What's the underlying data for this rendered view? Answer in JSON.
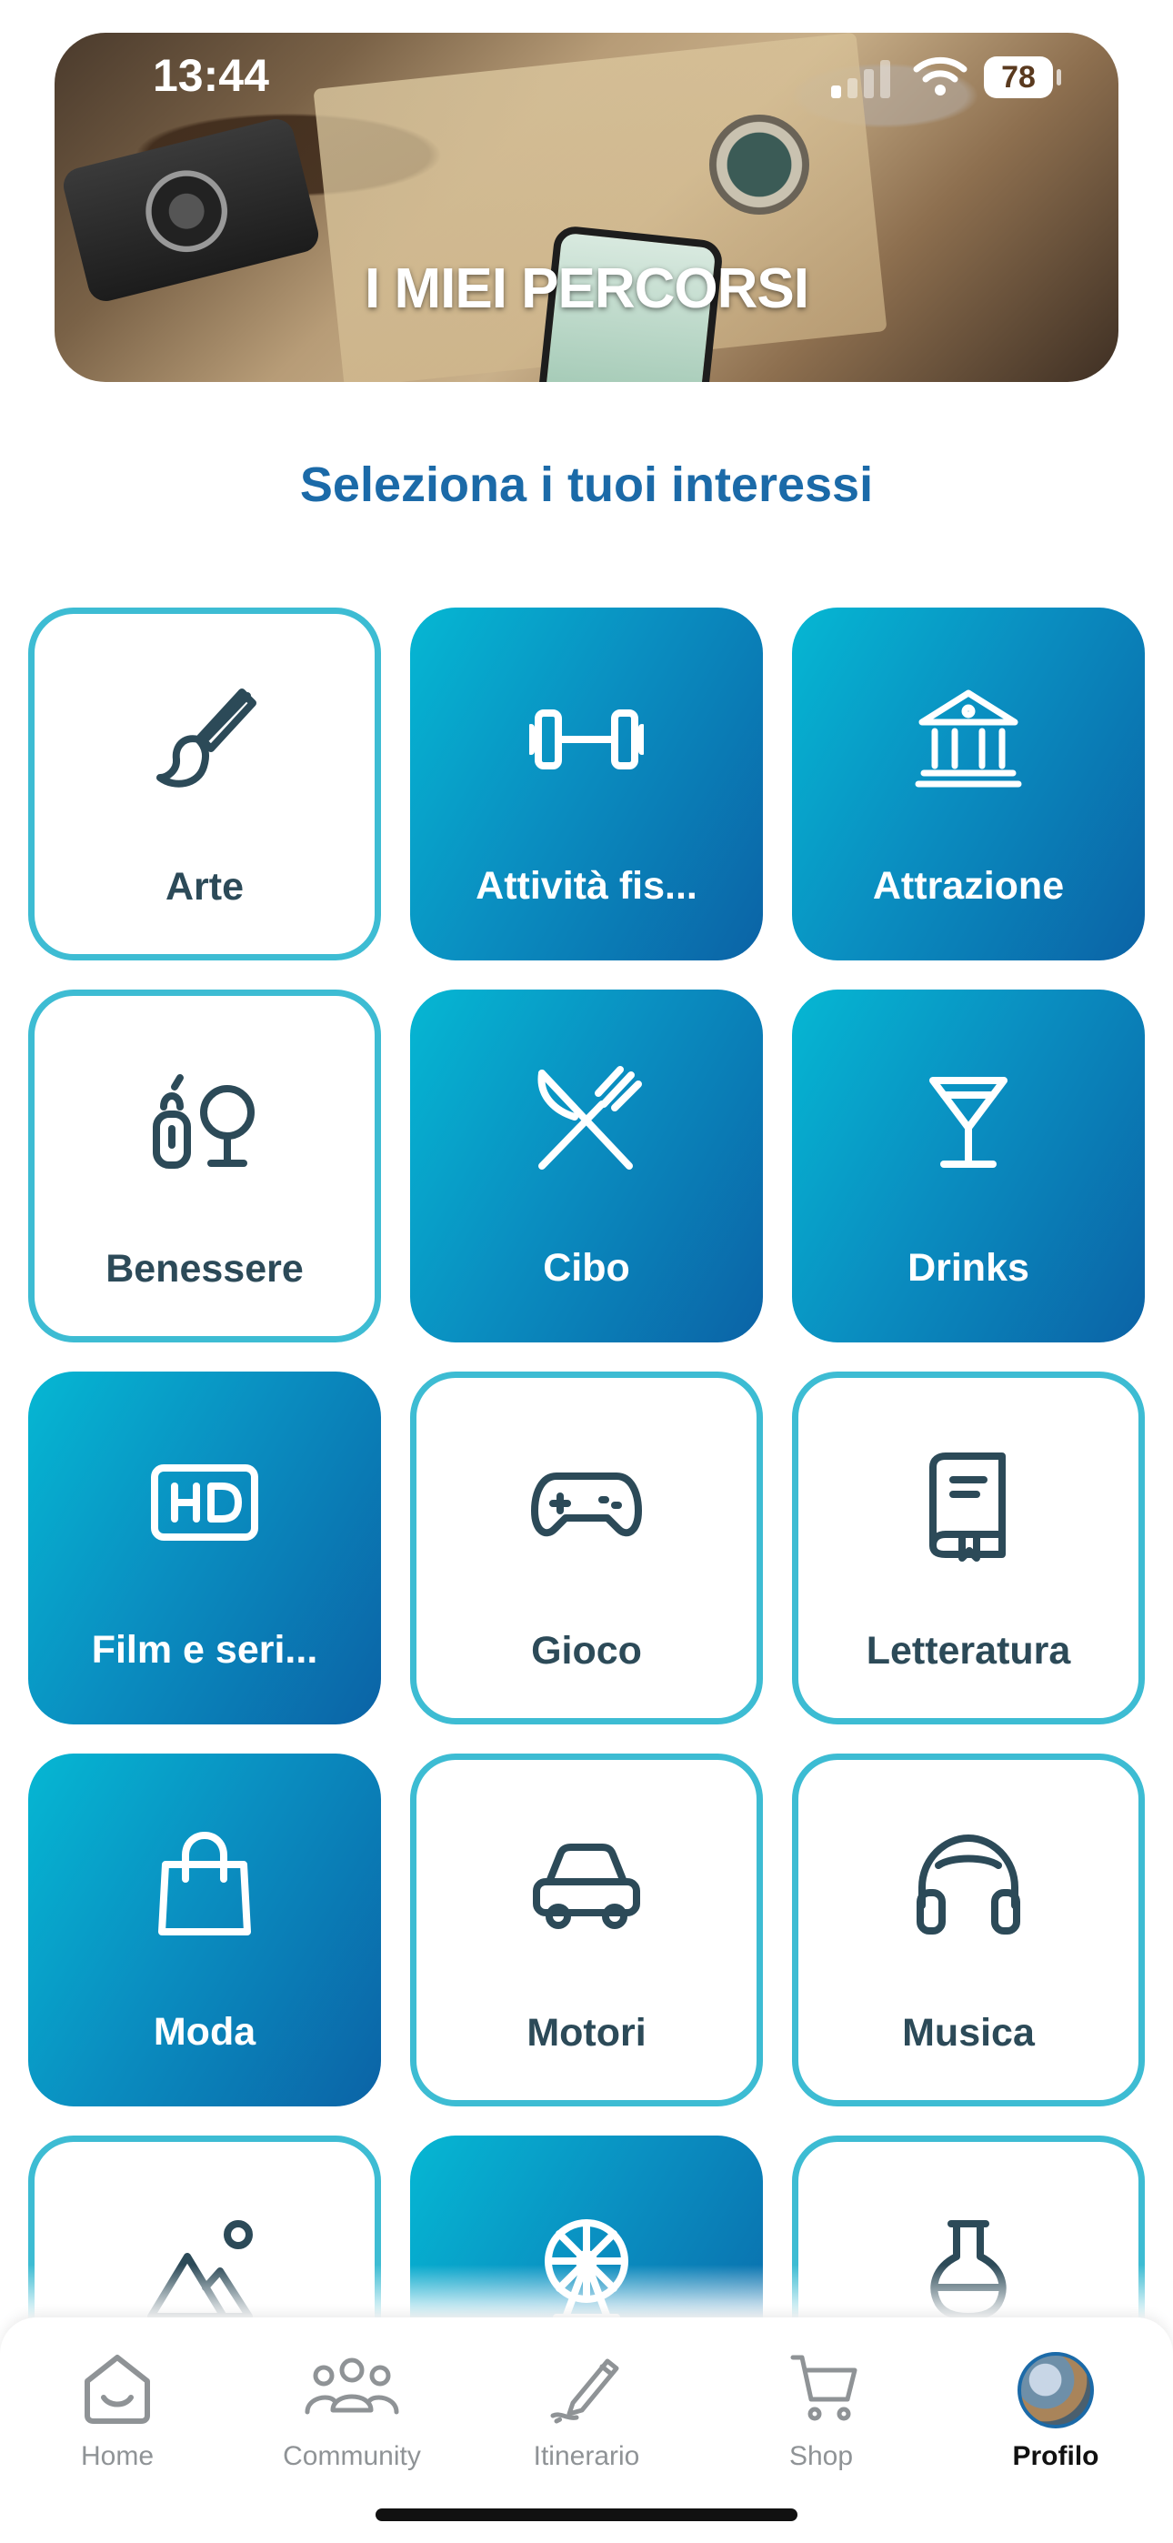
{
  "status_bar": {
    "time": "13:44",
    "battery": "78"
  },
  "banner": {
    "title": "I MIEI PERCORSI"
  },
  "section": {
    "title": "Seleziona i tuoi interessi"
  },
  "colors": {
    "accent": "#1b6aa8",
    "tile_gradient_start": "#05b7d3",
    "tile_gradient_end": "#0b63a6",
    "tile_border": "#3dbcd3",
    "icon_dark": "#2c4a58"
  },
  "interests": [
    {
      "label": "Arte",
      "selected": false,
      "icon": "paintbrush-icon"
    },
    {
      "label": "Attività fis...",
      "selected": true,
      "icon": "dumbbell-icon"
    },
    {
      "label": "Attrazione",
      "selected": true,
      "icon": "museum-icon"
    },
    {
      "label": "Benessere",
      "selected": false,
      "icon": "wellness-icon"
    },
    {
      "label": "Cibo",
      "selected": true,
      "icon": "fork-knife-icon"
    },
    {
      "label": "Drinks",
      "selected": true,
      "icon": "cocktail-icon"
    },
    {
      "label": "Film e seri...",
      "selected": true,
      "icon": "hd-icon"
    },
    {
      "label": "Gioco",
      "selected": false,
      "icon": "gamepad-icon"
    },
    {
      "label": "Letteratura",
      "selected": false,
      "icon": "book-icon"
    },
    {
      "label": "Moda",
      "selected": true,
      "icon": "shopping-bag-icon"
    },
    {
      "label": "Motori",
      "selected": false,
      "icon": "car-icon"
    },
    {
      "label": "Musica",
      "selected": false,
      "icon": "headphones-icon"
    },
    {
      "label": "",
      "selected": false,
      "icon": "landscape-icon"
    },
    {
      "label": "",
      "selected": true,
      "icon": "ferris-wheel-icon"
    },
    {
      "label": "",
      "selected": false,
      "icon": "flask-icon"
    }
  ],
  "nav": {
    "items": [
      {
        "label": "Home",
        "icon": "home-icon",
        "active": false
      },
      {
        "label": "Community",
        "icon": "people-icon",
        "active": false
      },
      {
        "label": "Itinerario",
        "icon": "pencil-icon",
        "active": false
      },
      {
        "label": "Shop",
        "icon": "cart-icon",
        "active": false
      },
      {
        "label": "Profilo",
        "icon": "avatar",
        "active": true
      }
    ]
  }
}
